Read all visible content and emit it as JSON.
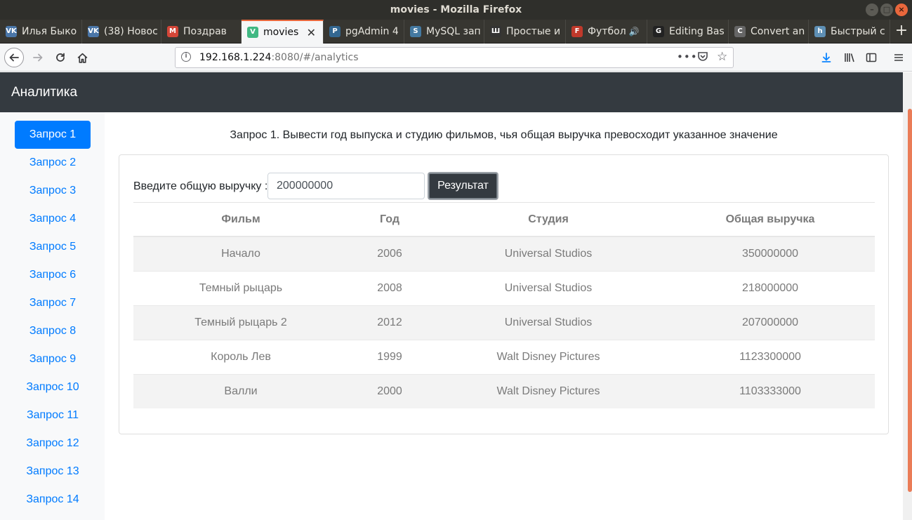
{
  "window": {
    "title": "movies - Mozilla Firefox"
  },
  "tabs": [
    {
      "title": "Илья Быко",
      "icon": "vk-icon",
      "color": "#4a76a8",
      "glyph": "VK"
    },
    {
      "title": "(38) Новос",
      "icon": "vk-icon",
      "color": "#4a76a8",
      "glyph": "VK"
    },
    {
      "title": "Поздрав",
      "icon": "gmail-icon",
      "color": "#d44638",
      "glyph": "M"
    },
    {
      "title": "movies",
      "icon": "vue-icon",
      "color": "#41b883",
      "glyph": "V",
      "active": true
    },
    {
      "title": "pgAdmin 4",
      "icon": "pgadmin-icon",
      "color": "#336791",
      "glyph": "P"
    },
    {
      "title": "MySQL зап",
      "icon": "mysql-icon",
      "color": "#4479a1",
      "glyph": "S"
    },
    {
      "title": "Простые и",
      "icon": "habr-icon",
      "color": "#333333",
      "glyph": "Ш"
    },
    {
      "title": "Футбол",
      "icon": "football-icon",
      "color": "#c0392b",
      "glyph": "F",
      "audio": true
    },
    {
      "title": "Editing Bas",
      "icon": "github-icon",
      "color": "#222222",
      "glyph": "G"
    },
    {
      "title": "Convert an",
      "icon": "cloud-icon",
      "color": "#666666",
      "glyph": "C"
    },
    {
      "title": "Быстрый с",
      "icon": "habr-h-icon",
      "color": "#5e8fb4",
      "glyph": "h"
    }
  ],
  "address": {
    "host": "192.168.1.224",
    "rest": ":8080/#/analytics"
  },
  "app": {
    "brand": "Аналитика"
  },
  "sidebar": {
    "items": [
      "Запрос 1",
      "Запрос 2",
      "Запрос 3",
      "Запрос 4",
      "Запрос 5",
      "Запрос 6",
      "Запрос 7",
      "Запрос 8",
      "Запрос 9",
      "Запрос 10",
      "Запрос 11",
      "Запрос 12",
      "Запрос 13",
      "Запрос 14"
    ],
    "active_index": 0
  },
  "main": {
    "heading": "Запрос 1. Вывести год выпуска и студию фильмов, чья общая выручка превосходит указанное значение",
    "form": {
      "label": "Введите общую выручку :",
      "value": "200000000",
      "button": "Результат"
    },
    "table": {
      "columns": [
        "Фильм",
        "Год",
        "Студия",
        "Общая выручка"
      ],
      "rows": [
        [
          "Начало",
          "2006",
          "Universal Studios",
          "350000000"
        ],
        [
          "Темный рыцарь",
          "2008",
          "Universal Studios",
          "218000000"
        ],
        [
          "Темный рыцарь 2",
          "2012",
          "Universal Studios",
          "207000000"
        ],
        [
          "Король Лев",
          "1999",
          "Walt Disney Pictures",
          "1123300000"
        ],
        [
          "Валли",
          "2000",
          "Walt Disney Pictures",
          "1103333000"
        ]
      ]
    }
  },
  "colors": {
    "accent": "#007bff",
    "header": "#343a40",
    "firefox_accent": "#e9673c"
  }
}
